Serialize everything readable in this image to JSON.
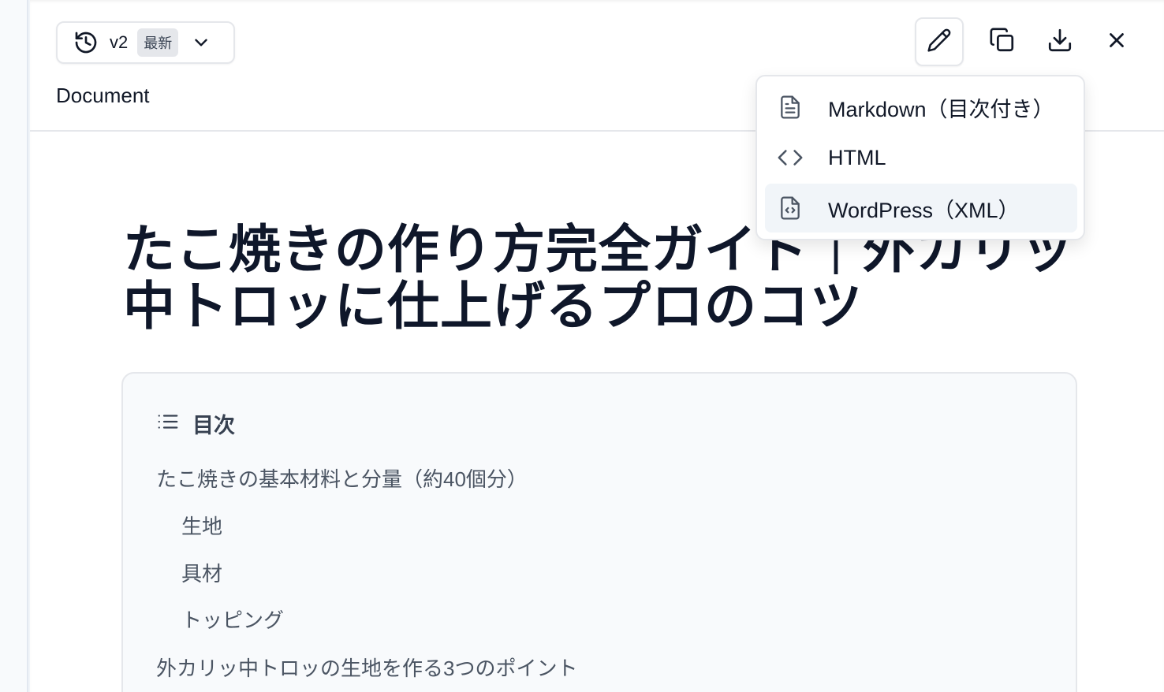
{
  "header": {
    "version": "v2",
    "version_badge": "最新",
    "doc_label": "Document"
  },
  "toolbar": {
    "icons": [
      "history-icon",
      "chevron-down-icon",
      "pencil-icon",
      "copy-icon",
      "download-icon",
      "close-icon"
    ]
  },
  "download_menu": {
    "items": [
      {
        "label": "Markdown（目次付き）",
        "icon": "file-text-icon"
      },
      {
        "label": "HTML",
        "icon": "code-icon"
      },
      {
        "label": "WordPress（XML）",
        "icon": "file-code-icon"
      }
    ],
    "highlighted_index": 2
  },
  "article": {
    "title": "たこ焼きの作り方完全ガイド｜外カリッ中トロッに仕上げるプロのコツ"
  },
  "toc": {
    "title": "目次",
    "items": [
      {
        "label": "たこ焼きの基本材料と分量（約40個分）",
        "level": 1
      },
      {
        "label": "生地",
        "level": 2
      },
      {
        "label": "具材",
        "level": 2
      },
      {
        "label": "トッピング",
        "level": 2
      },
      {
        "label": "外カリッ中トロッの生地を作る3つのポイント",
        "level": 1
      }
    ]
  }
}
